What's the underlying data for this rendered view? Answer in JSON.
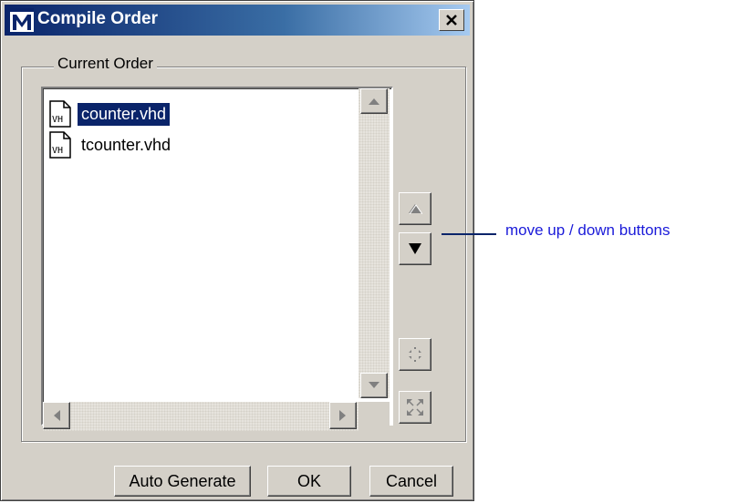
{
  "window": {
    "title": "Compile Order",
    "app_icon": "modelsim-m-icon",
    "close_label": "×"
  },
  "group": {
    "label": "Current Order"
  },
  "files": [
    {
      "name": "counter.vhd",
      "icon": "vhdl-file-icon",
      "icon_text": "VH",
      "selected": true
    },
    {
      "name": "tcounter.vhd",
      "icon": "vhdl-file-icon",
      "icon_text": "VH",
      "selected": false
    }
  ],
  "side_buttons": [
    {
      "name": "move-up",
      "icon": "triangle-up-icon",
      "enabled": false
    },
    {
      "name": "move-down",
      "icon": "triangle-down-icon",
      "enabled": true
    },
    {
      "name": "collapse",
      "icon": "collapse-arrows-icon",
      "enabled": false
    },
    {
      "name": "expand",
      "icon": "expand-arrows-icon",
      "enabled": false
    }
  ],
  "buttons": {
    "auto_generate": "Auto Generate",
    "ok": "OK",
    "cancel": "Cancel"
  },
  "annotation": {
    "text": "move up / down buttons",
    "color": "#1a1ad9"
  },
  "colors": {
    "selection": "#0a246a",
    "face": "#d4d0c8"
  }
}
